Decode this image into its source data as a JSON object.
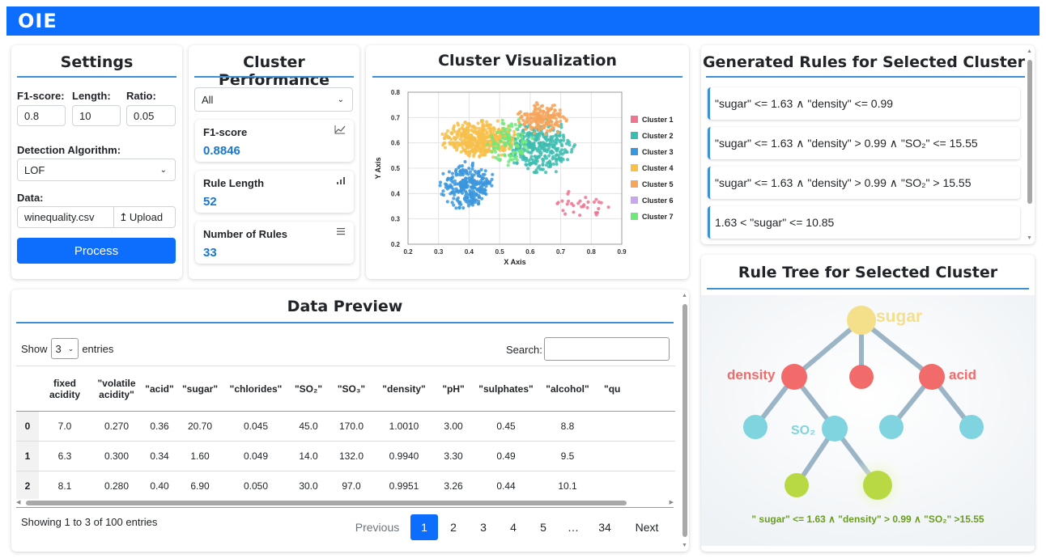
{
  "app": {
    "title": "OIE"
  },
  "settings": {
    "title": "Settings",
    "f1_label": "F1-score:",
    "f1_value": "0.8",
    "length_label": "Length:",
    "length_value": "10",
    "ratio_label": "Ratio:",
    "ratio_value": "0.05",
    "algo_label": "Detection Algorithm:",
    "algo_value": "LOF",
    "data_label": "Data:",
    "file_value": "winequality.csv",
    "upload_label": "Upload",
    "process_label": "Process"
  },
  "performance": {
    "title": "Cluster Performance",
    "cluster_select": "All",
    "metrics": [
      {
        "label": "F1-score",
        "value": "0.8846",
        "icon": "line-chart-icon"
      },
      {
        "label": "Rule Length",
        "value": "52",
        "icon": "bar-chart-icon"
      },
      {
        "label": "Number of Rules",
        "value": "33",
        "icon": "list-icon"
      }
    ]
  },
  "visualization": {
    "title": "Cluster Visualization",
    "chart_data": {
      "type": "scatter",
      "xlabel": "X Axis",
      "ylabel": "Y Axis",
      "xlim": [
        0.2,
        0.9
      ],
      "ylim": [
        0.2,
        0.8
      ],
      "x_ticks": [
        "0.2",
        "0.3",
        "0.4",
        "0.5",
        "0.6",
        "0.7",
        "0.8",
        "0.9"
      ],
      "y_ticks": [
        "0.2",
        "0.3",
        "0.4",
        "0.5",
        "0.6",
        "0.7",
        "0.8"
      ],
      "grid": true,
      "legend_position": "right",
      "series": [
        {
          "name": "Cluster 1",
          "color": "#f0738f",
          "center": [
            0.77,
            0.36
          ],
          "spread": [
            0.045,
            0.03
          ],
          "count": 30
        },
        {
          "name": "Cluster 2",
          "color": "#3dbdb0",
          "center": [
            0.635,
            0.585
          ],
          "spread": [
            0.05,
            0.05
          ],
          "count": 320
        },
        {
          "name": "Cluster 3",
          "color": "#3b97dd",
          "center": [
            0.395,
            0.43
          ],
          "spread": [
            0.042,
            0.045
          ],
          "count": 260
        },
        {
          "name": "Cluster 4",
          "color": "#f7c04a",
          "center": [
            0.44,
            0.615
          ],
          "spread": [
            0.06,
            0.035
          ],
          "count": 420
        },
        {
          "name": "Cluster 5",
          "color": "#f6a55b",
          "center": [
            0.645,
            0.695
          ],
          "spread": [
            0.04,
            0.03
          ],
          "count": 170
        },
        {
          "name": "Cluster 6",
          "color": "#c9a7ef",
          "center": [
            0.5,
            0.6
          ],
          "spread": [
            0.01,
            0.01
          ],
          "count": 0
        },
        {
          "name": "Cluster 7",
          "color": "#6fe87a",
          "center": [
            0.53,
            0.6
          ],
          "spread": [
            0.035,
            0.045
          ],
          "count": 90
        }
      ]
    }
  },
  "rules": {
    "title": "Generated Rules for Selected Cluster",
    "items": [
      "\"sugar\" <= 1.63 ∧ \"density\" <= 0.99",
      "\"sugar\" <= 1.63 ∧ \"density\" > 0.99 ∧ \"SO₂\" <= 15.55",
      "\"sugar\" <= 1.63 ∧ \"density\" > 0.99 ∧ \"SO₂\" > 15.55",
      "1.63 < \"sugar\" <= 10.85"
    ]
  },
  "preview": {
    "title": "Data Preview",
    "show_label": "Show",
    "entries_value": "3",
    "entries_label": "entries",
    "search_label": "Search:",
    "columns": [
      "",
      "fixed acidity",
      "\"volatile acidity\"",
      "\"acid\"",
      "\"sugar\"",
      "\"chlorides\"",
      "\"SO₂\"",
      "\"SO₃\"",
      "\"density\"",
      "\"pH\"",
      "\"sulphates\"",
      "\"alcohol\"",
      "\"qu"
    ],
    "rows": [
      [
        "0",
        "7.0",
        "0.270",
        "0.36",
        "20.70",
        "0.045",
        "45.0",
        "170.0",
        "1.0010",
        "3.00",
        "0.45",
        "8.8",
        ""
      ],
      [
        "1",
        "6.3",
        "0.300",
        "0.34",
        "1.60",
        "0.049",
        "14.0",
        "132.0",
        "0.9940",
        "3.30",
        "0.49",
        "9.5",
        ""
      ],
      [
        "2",
        "8.1",
        "0.280",
        "0.40",
        "6.90",
        "0.050",
        "30.0",
        "97.0",
        "0.9951",
        "3.26",
        "0.44",
        "10.1",
        ""
      ]
    ],
    "info": "Showing 1 to 3 of 100 entries",
    "pagination": {
      "previous": "Previous",
      "pages": [
        "1",
        "2",
        "3",
        "4",
        "5",
        "…",
        "34"
      ],
      "next": "Next",
      "active": "1"
    }
  },
  "tree": {
    "title": "Rule Tree for Selected Cluster",
    "root_label": "sugar",
    "left_label": "density",
    "right_label": "acid",
    "so2_label": "SO₂",
    "rule_text": "\" sugar\" <= 1.63 ∧ \"density\" > 0.99 ∧ \"SO₂\" >15.55",
    "colors": {
      "root": "#f4e08a",
      "level1": "#f26b6b",
      "level2": "#7fd4df",
      "leaf": "#b8d943",
      "edge": "#9bb4c6"
    }
  }
}
